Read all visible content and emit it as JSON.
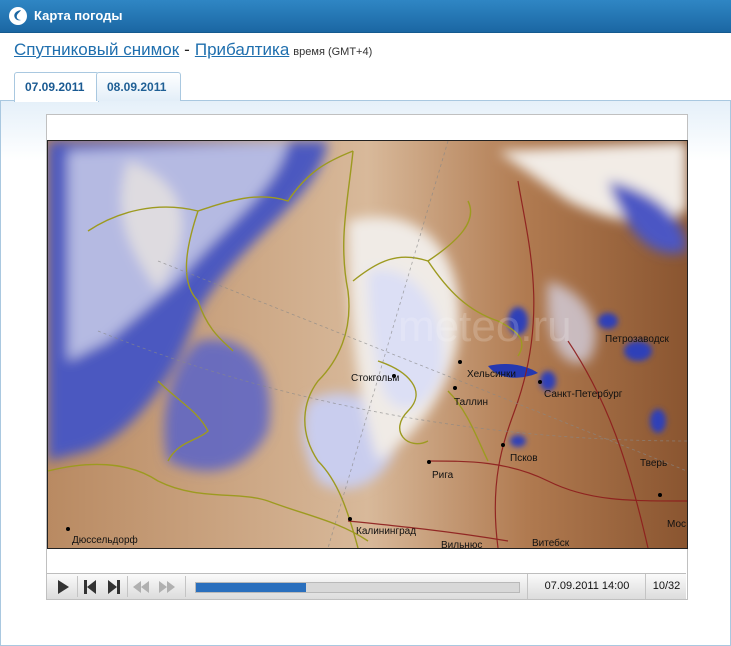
{
  "header": {
    "title": "Карта погоды",
    "logo_icon": "weather-logo-icon"
  },
  "heading": {
    "link1": "Спутниковый снимок",
    "separator": "-",
    "link2": "Прибалтика",
    "timezone": "время (GMT+4)"
  },
  "tabs": [
    {
      "label": "07.09.2011",
      "active": true
    },
    {
      "label": "08.09.2011",
      "active": false
    }
  ],
  "map": {
    "watermark": "meteo.ru",
    "cities": [
      "Стокгольм",
      "Хельсинки",
      "Санкт-Петербург",
      "Таллин",
      "Петрозаводск",
      "Рига",
      "Псков",
      "Тверь",
      "Мос",
      "Калининград",
      "Дюссельдорф",
      "Витебск",
      "Вильнюс"
    ]
  },
  "player": {
    "icons": [
      "play-icon",
      "step-back-icon",
      "step-forward-icon",
      "rewind-icon",
      "fast-forward-icon"
    ],
    "progress": 0.34,
    "datetime": "07.09.2011 14:00",
    "frame_counter": "10/32"
  },
  "colors": {
    "header": "#1f72b2",
    "link": "#1f6fae",
    "progress": "#2a6fbd",
    "cloud": "#4a5fc8",
    "land": "#9a6a45"
  }
}
